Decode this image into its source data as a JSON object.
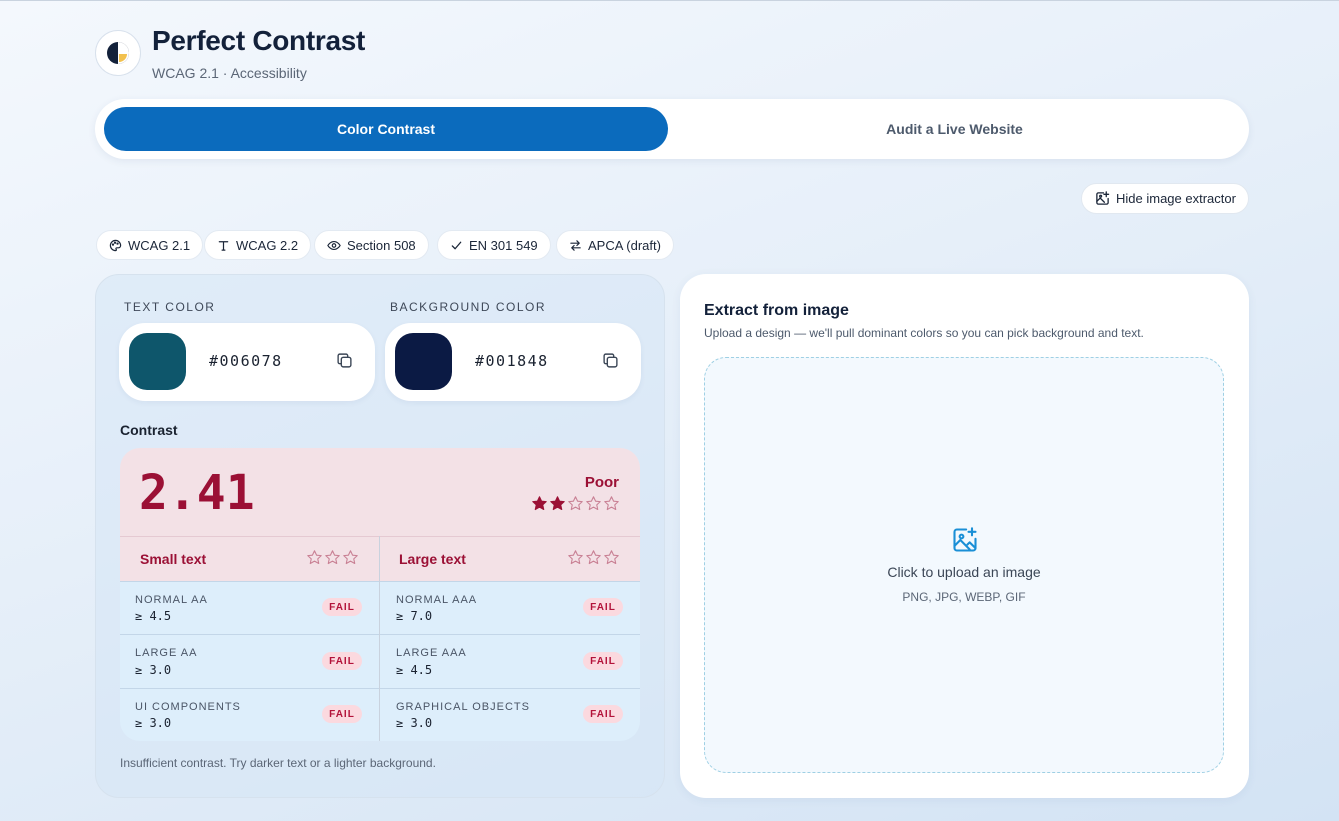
{
  "app": {
    "title": "Perfect Contrast",
    "subtitle": "WCAG 2.1 · Accessibility",
    "logo_icon": "contrast-logo-icon"
  },
  "tabs": [
    {
      "label": "Color Contrast",
      "active": true
    },
    {
      "label": "Audit a Live Website",
      "active": false
    }
  ],
  "toolbar": {
    "hide_extractor_label": "Hide image extractor",
    "hide_extractor_icon": "image-plus-icon"
  },
  "standards": [
    {
      "label": "WCAG 2.1",
      "icon": "palette-icon"
    },
    {
      "label": "WCAG 2.2",
      "icon": "type-icon"
    },
    {
      "label": "Section 508",
      "icon": "eye-icon"
    },
    {
      "label": "EN 301 549",
      "icon": "check-icon"
    },
    {
      "label": "APCA (draft)",
      "icon": "swap-arrows-icon"
    }
  ],
  "text_color": {
    "label": "TEXT COLOR",
    "hex": "#006078",
    "swatch": "#0e566b"
  },
  "background_color": {
    "label": "BACKGROUND COLOR",
    "hex": "#001848",
    "swatch": "#0b1a44"
  },
  "contrast": {
    "label": "Contrast",
    "ratio": "2.41",
    "rating": "Poor",
    "rating_stars": 2,
    "rating_stars_total": 5,
    "small_text": {
      "label": "Small text",
      "stars": 0,
      "stars_total": 3
    },
    "large_text": {
      "label": "Large text",
      "stars": 0,
      "stars_total": 3
    },
    "criteria": [
      {
        "name": "NORMAL AA",
        "threshold": "≥ 4.5",
        "status": "FAIL"
      },
      {
        "name": "NORMAL AAA",
        "threshold": "≥ 7.0",
        "status": "FAIL"
      },
      {
        "name": "LARGE AA",
        "threshold": "≥ 3.0",
        "status": "FAIL"
      },
      {
        "name": "LARGE AAA",
        "threshold": "≥ 4.5",
        "status": "FAIL"
      },
      {
        "name": "UI COMPONENTS",
        "threshold": "≥ 3.0",
        "status": "FAIL"
      },
      {
        "name": "GRAPHICAL OBJECTS",
        "threshold": "≥ 3.0",
        "status": "FAIL"
      }
    ],
    "hint": "Insufficient contrast. Try darker text or a lighter background."
  },
  "extractor": {
    "title": "Extract from image",
    "subtitle": "Upload a design — we'll pull dominant colors so you can pick background and text.",
    "upload_label": "Click to upload an image",
    "formats": "PNG, JPG, WEBP, GIF",
    "upload_icon": "image-upload-icon"
  },
  "colors": {
    "accent": "#0b6bbd",
    "fail": "#9b1035",
    "fail_badge_bg": "#fbd9df"
  }
}
